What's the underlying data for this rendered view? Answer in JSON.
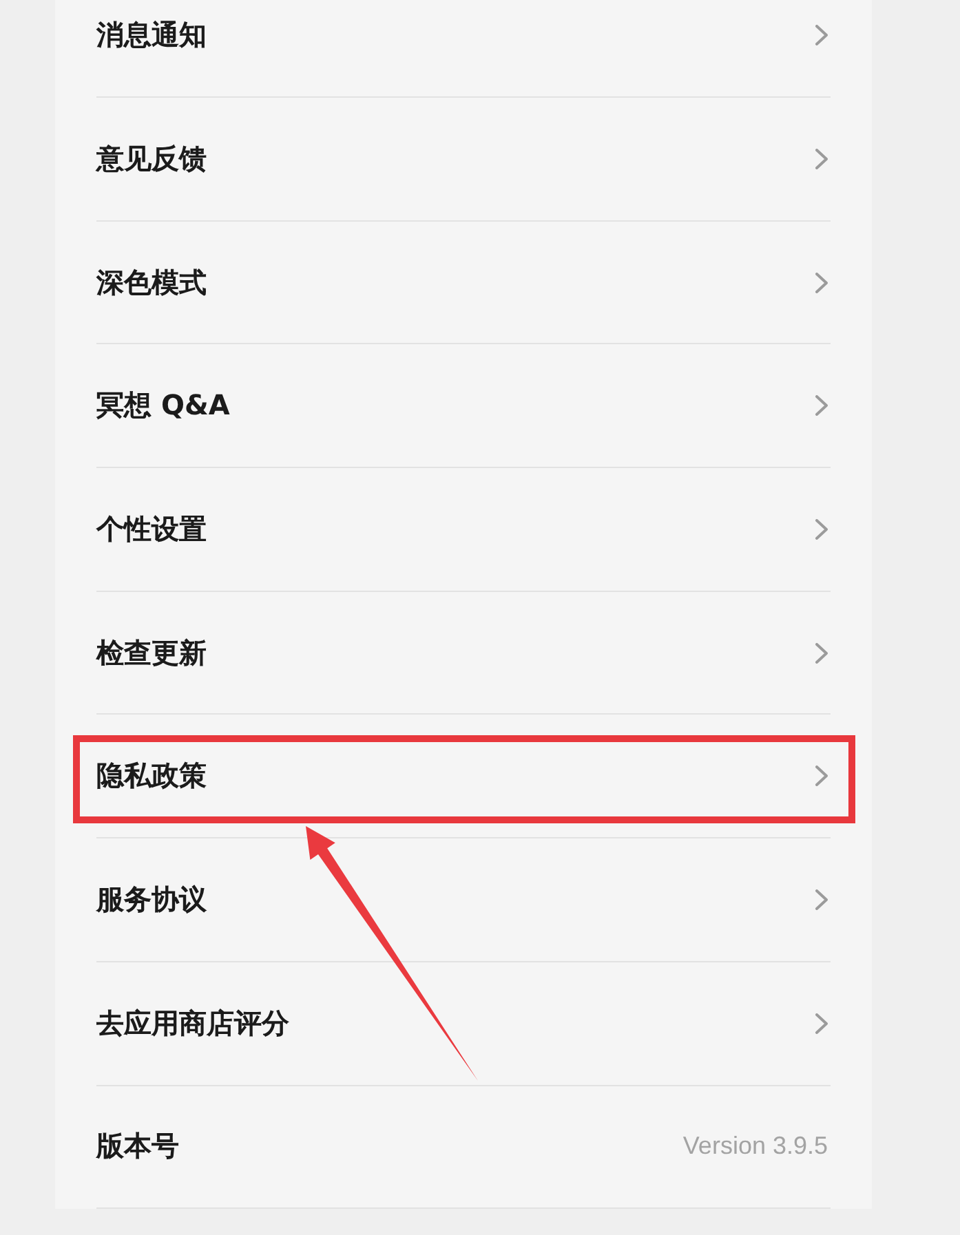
{
  "settings": {
    "items": [
      {
        "kind": "link",
        "label": "消息通知",
        "highlighted": false
      },
      {
        "kind": "link",
        "label": "意见反馈",
        "highlighted": false
      },
      {
        "kind": "link",
        "label": "深色模式",
        "highlighted": false
      },
      {
        "kind": "link",
        "label": "冥想 Q&A",
        "highlighted": false
      },
      {
        "kind": "link",
        "label": "个性设置",
        "highlighted": false
      },
      {
        "kind": "link",
        "label": "检查更新",
        "highlighted": false
      },
      {
        "kind": "link",
        "label": "隐私政策",
        "highlighted": true
      },
      {
        "kind": "link",
        "label": "服务协议",
        "highlighted": false
      },
      {
        "kind": "link",
        "label": "去应用商店评分",
        "highlighted": false
      },
      {
        "kind": "value",
        "label": "版本号",
        "value": "Version 3.9.5",
        "highlighted": false
      }
    ]
  }
}
